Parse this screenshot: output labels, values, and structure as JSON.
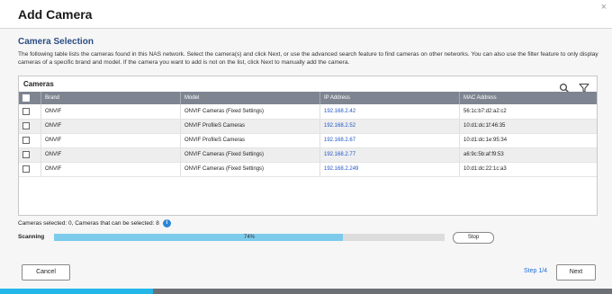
{
  "window": {
    "title": "Add Camera",
    "close_glyph": "×"
  },
  "section": {
    "title": "Camera Selection",
    "description": "The following table lists the cameras found in this NAS network. Select the camera(s) and click Next, or use the advanced search feature to find cameras on other networks. You can also use the filter feature to only display cameras of a specific brand and model. If the camera you want to add is not on the list, click Next to manually add the camera."
  },
  "panel": {
    "title": "Cameras",
    "icons": [
      "search-icon",
      "filter-icon"
    ]
  },
  "table": {
    "headers": {
      "brand": "Brand",
      "model": "Model",
      "ip": "IP Address",
      "mac": "MAC Address"
    },
    "rows": [
      {
        "brand": "ONVIF",
        "model": "ONVIF Cameras (Fixed Settings)",
        "ip": "192.168.2.42",
        "mac": "56:1c:b7:d2:a2:c2"
      },
      {
        "brand": "ONVIF",
        "model": "ONVIF ProfileS Cameras",
        "ip": "192.168.2.52",
        "mac": "10:d1:dc:1f:46:35"
      },
      {
        "brand": "ONVIF",
        "model": "ONVIF ProfileS Cameras",
        "ip": "192.168.2.67",
        "mac": "10:d1:dc:1e:95:34"
      },
      {
        "brand": "ONVIF",
        "model": "ONVIF Cameras (Fixed Settings)",
        "ip": "192.168.2.77",
        "mac": "a6:9c:5b:af:f9:53"
      },
      {
        "brand": "ONVIF",
        "model": "ONVIF Cameras (Fixed Settings)",
        "ip": "192.168.2.249",
        "mac": "10:d1:dc:22:1c:a3"
      }
    ]
  },
  "selection": {
    "text": "Cameras selected:  0, Cameras that can be selected:  8",
    "info_glyph": "i"
  },
  "scanning": {
    "label": "Scanning",
    "progress": 0.74,
    "progress_text": "74%",
    "stop_label": "Stop"
  },
  "footer": {
    "cancel_label": "Cancel",
    "step_text": "Step 1/4",
    "next_label": "Next",
    "wizard_progress": 0.25
  },
  "colors": {
    "accent": "#23b6e8",
    "link": "#1f55c4",
    "header_bg": "#7e8591",
    "progress_fill": "#7dcbeb"
  }
}
